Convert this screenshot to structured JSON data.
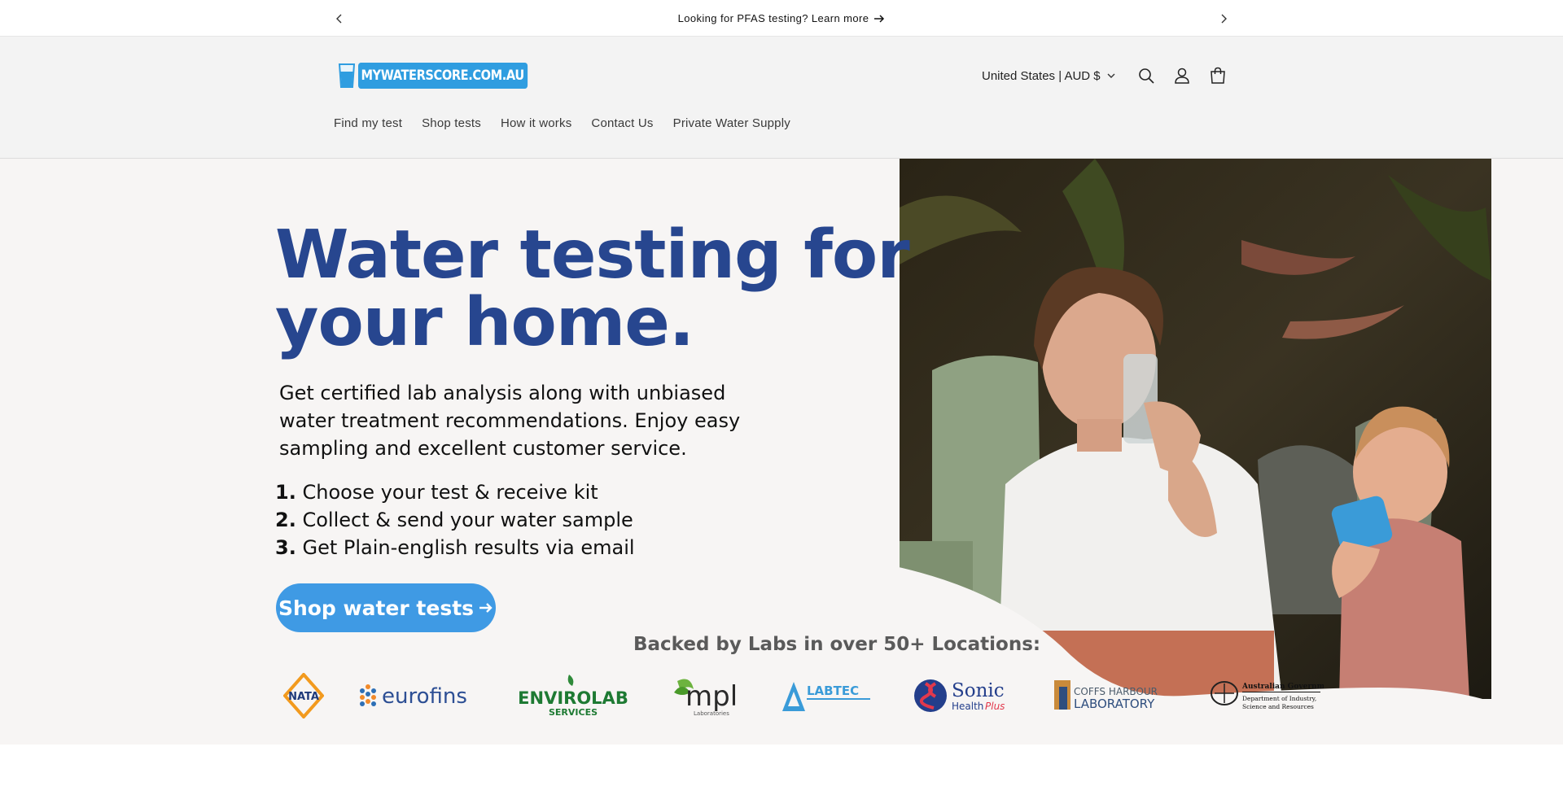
{
  "announcement": {
    "text": "Looking for PFAS testing? Learn more",
    "prev_icon": "chevron-left-icon",
    "next_icon": "chevron-right-icon"
  },
  "header": {
    "logo_text": "MYWATERSCORE.COM.AU",
    "country_selector": "United States | AUD $",
    "icons": [
      "search-icon",
      "account-icon",
      "cart-icon"
    ]
  },
  "nav": {
    "items": [
      "Find my test",
      "Shop tests",
      "How it works",
      "Contact Us",
      "Private Water Supply"
    ]
  },
  "hero": {
    "headline_line1": "Water testing for",
    "headline_line2": "your home.",
    "subtext_line1": "Get certified lab analysis along with unbiased",
    "subtext_line2": "water treatment recommendations. Enjoy easy",
    "subtext_line3": "sampling and excellent customer service.",
    "steps": [
      {
        "num": "1.",
        "text": "Choose your test & receive kit"
      },
      {
        "num": "2.",
        "text": "Collect & send your water sample"
      },
      {
        "num": "3.",
        "text": "Get Plain-english results via email"
      }
    ],
    "cta_label": "Shop water tests",
    "backed_by": "Backed by Labs in over 50+ Locations:"
  },
  "labs": {
    "nata": "NATA",
    "eurofins": "eurofins",
    "envirolab_top": "ENVIROLAB",
    "envirolab_bottom": "SERVICES",
    "mpl": "mpl",
    "mpl_sub": "Laboratories",
    "labtec": "LABTEC",
    "sonic_top": "Sonic",
    "sonic_health": "Health",
    "sonic_plus": "Plus",
    "coffs_top": "COFFS HARBOUR",
    "coffs_bottom": "LABORATORY",
    "gov_line1": "Australian Government",
    "gov_line2": "Department of Industry,",
    "gov_line3": "Science and Resources"
  },
  "colors": {
    "headline": "#27468f",
    "cta": "#3f9ae4",
    "logo_blue": "#2f9de0",
    "hero_bg": "#f7f5f4",
    "header_bg": "#f3f3f3"
  }
}
